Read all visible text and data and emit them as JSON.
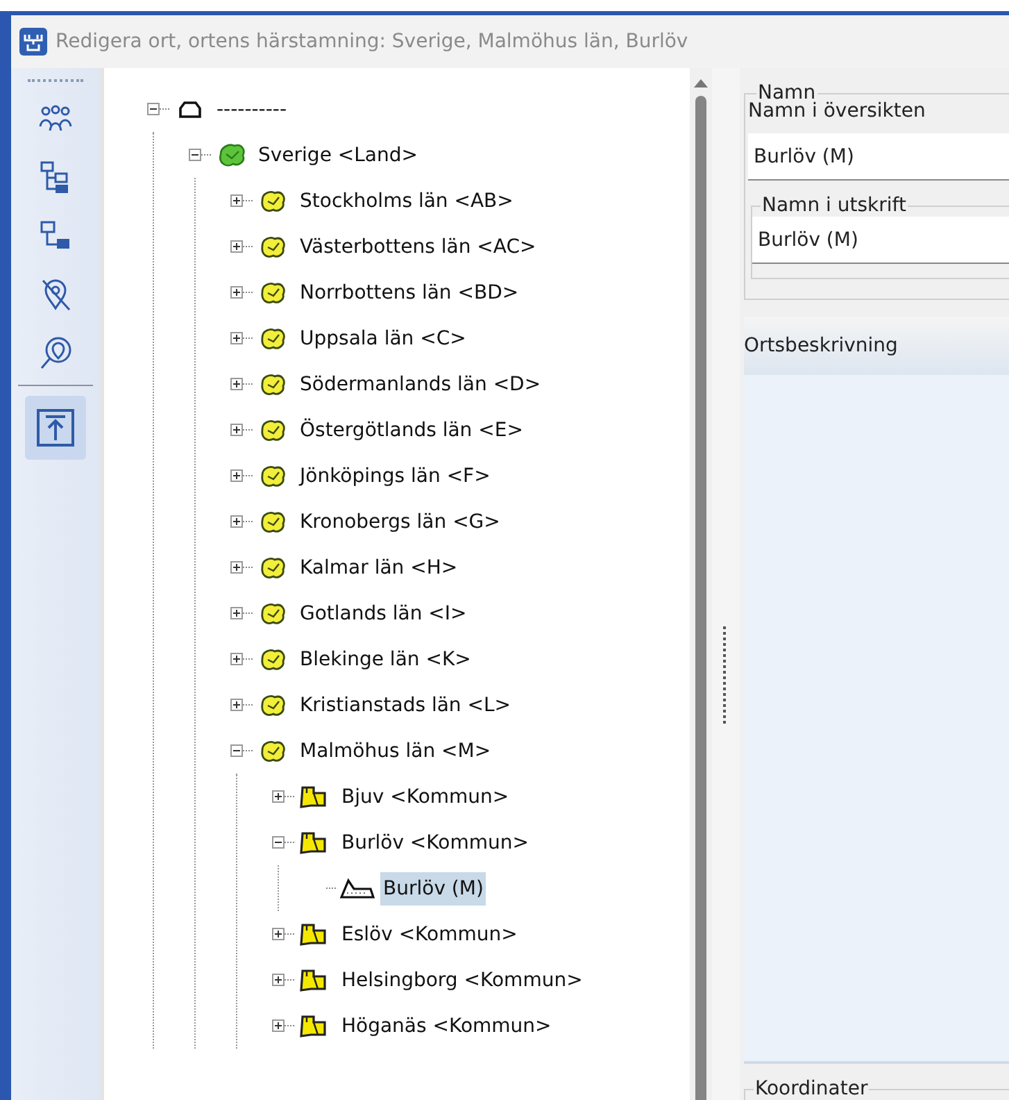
{
  "window": {
    "title": "Redigera ort, ortens härstamning: Sverige, Malmöhus län, Burlöv"
  },
  "toolbar": [
    {
      "kind": "people",
      "selected": false
    },
    {
      "kind": "tree",
      "selected": false
    },
    {
      "kind": "branch",
      "selected": false
    },
    {
      "kind": "pin-off",
      "selected": false
    },
    {
      "kind": "pin-search",
      "selected": false
    },
    {
      "kind": "move-top",
      "selected": true
    }
  ],
  "tree": [
    {
      "label": "----------",
      "kind": "root",
      "expanded": true,
      "selected": false,
      "children": [
        {
          "label": "Sverige <Land>",
          "kind": "country",
          "expanded": true,
          "selected": false,
          "children": [
            {
              "label": "Stockholms län <AB>",
              "kind": "county",
              "expanded": false,
              "selected": false
            },
            {
              "label": "Västerbottens län <AC>",
              "kind": "county",
              "expanded": false,
              "selected": false
            },
            {
              "label": "Norrbottens län <BD>",
              "kind": "county",
              "expanded": false,
              "selected": false
            },
            {
              "label": "Uppsala län <C>",
              "kind": "county",
              "expanded": false,
              "selected": false
            },
            {
              "label": "Södermanlands län <D>",
              "kind": "county",
              "expanded": false,
              "selected": false
            },
            {
              "label": "Östergötlands län <E>",
              "kind": "county",
              "expanded": false,
              "selected": false
            },
            {
              "label": "Jönköpings län <F>",
              "kind": "county",
              "expanded": false,
              "selected": false
            },
            {
              "label": "Kronobergs län <G>",
              "kind": "county",
              "expanded": false,
              "selected": false
            },
            {
              "label": "Kalmar län <H>",
              "kind": "county",
              "expanded": false,
              "selected": false
            },
            {
              "label": "Gotlands län <I>",
              "kind": "county",
              "expanded": false,
              "selected": false
            },
            {
              "label": "Blekinge län <K>",
              "kind": "county",
              "expanded": false,
              "selected": false
            },
            {
              "label": "Kristianstads län <L>",
              "kind": "county",
              "expanded": false,
              "selected": false
            },
            {
              "label": "Malmöhus län <M>",
              "kind": "county",
              "expanded": true,
              "selected": false,
              "children": [
                {
                  "label": "Bjuv <Kommun>",
                  "kind": "municipality",
                  "expanded": false,
                  "selected": false
                },
                {
                  "label": "Burlöv <Kommun>",
                  "kind": "municipality",
                  "expanded": true,
                  "selected": false,
                  "children": [
                    {
                      "label": "Burlöv (M)",
                      "kind": "place",
                      "selected": true
                    }
                  ]
                },
                {
                  "label": "Eslöv <Kommun>",
                  "kind": "municipality",
                  "expanded": false,
                  "selected": false
                },
                {
                  "label": "Helsingborg <Kommun>",
                  "kind": "municipality",
                  "expanded": false,
                  "selected": false
                },
                {
                  "label": "Höganäs <Kommun>",
                  "kind": "municipality",
                  "expanded": false,
                  "selected": false
                }
              ]
            }
          ]
        }
      ]
    }
  ],
  "name_group": {
    "legend": "Namn",
    "overview_label": "Namn i översikten",
    "overview_value": "Burlöv (M)",
    "print_legend": "Namn i utskrift",
    "print_value": "Burlöv (M)"
  },
  "description": {
    "heading": "Ortsbeskrivning"
  },
  "coordinates": {
    "legend": "Koordinater"
  }
}
